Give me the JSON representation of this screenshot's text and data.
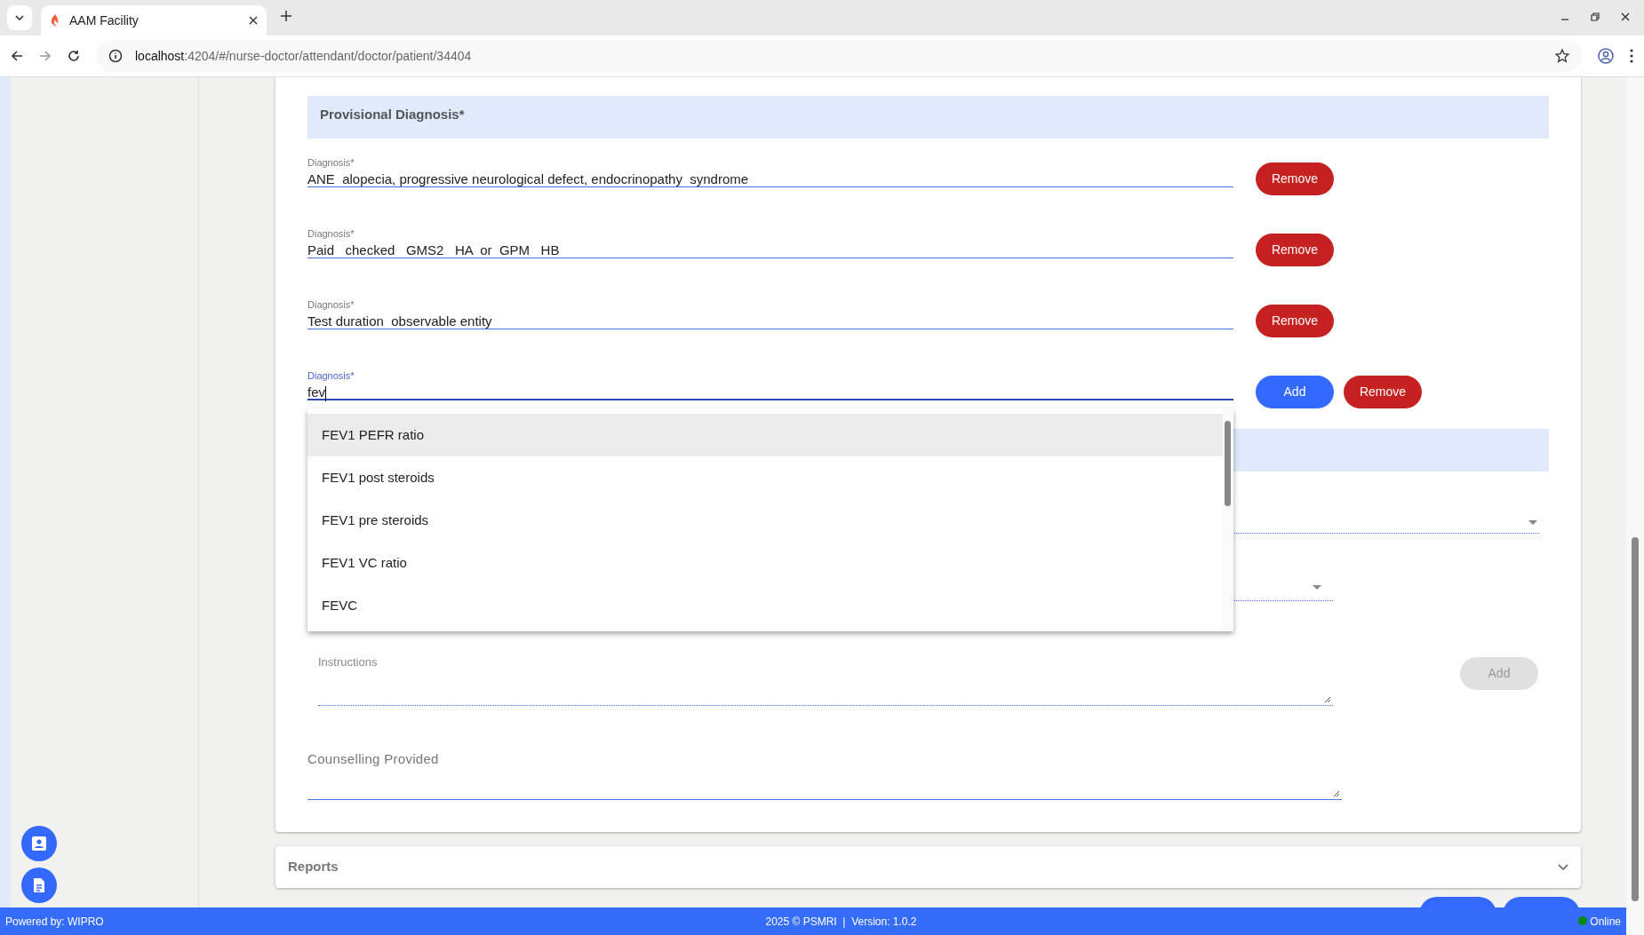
{
  "browser": {
    "tab_title": "AAM Facility",
    "url_host": "localhost",
    "url_path": ":4204/#/nurse-doctor/attendant/doctor/patient/34404"
  },
  "section_title": "Provisional Diagnosis*",
  "diagnoses": [
    {
      "label": "Diagnosis*",
      "value": "ANE  alopecia, progressive neurological defect, endocrinopathy  syndrome",
      "focused": false,
      "buttons": [
        {
          "kind": "remove",
          "label": "Remove"
        }
      ]
    },
    {
      "label": "Diagnosis*",
      "value": "Paid   checked   GMS2   HA  or  GPM   HB",
      "focused": false,
      "buttons": [
        {
          "kind": "remove",
          "label": "Remove"
        }
      ]
    },
    {
      "label": "Diagnosis*",
      "value": "Test duration  observable entity",
      "focused": false,
      "buttons": [
        {
          "kind": "remove",
          "label": "Remove"
        }
      ]
    },
    {
      "label": "Diagnosis*",
      "value": "fev",
      "focused": true,
      "buttons": [
        {
          "kind": "add",
          "label": "Add"
        },
        {
          "kind": "remove",
          "label": "Remove"
        }
      ]
    }
  ],
  "suggestions": [
    {
      "label": "FEV1 PEFR ratio",
      "selected": true
    },
    {
      "label": "FEV1 post steroids",
      "selected": false
    },
    {
      "label": "FEV1 pre steroids",
      "selected": false
    },
    {
      "label": "FEV1 VC ratio",
      "selected": false
    },
    {
      "label": "FEVC",
      "selected": false
    }
  ],
  "instructions": {
    "placeholder": "Instructions",
    "add_button": {
      "label": "Add",
      "disabled": true
    }
  },
  "counselling": {
    "placeholder": "Counselling Provided"
  },
  "reports": {
    "title": "Reports",
    "expanded": false
  },
  "footer": {
    "powered_by": "Powered by: WIPRO",
    "center": "2025 © PSMRI  |  Version: 1.0.2",
    "status": "Online",
    "online": true
  }
}
